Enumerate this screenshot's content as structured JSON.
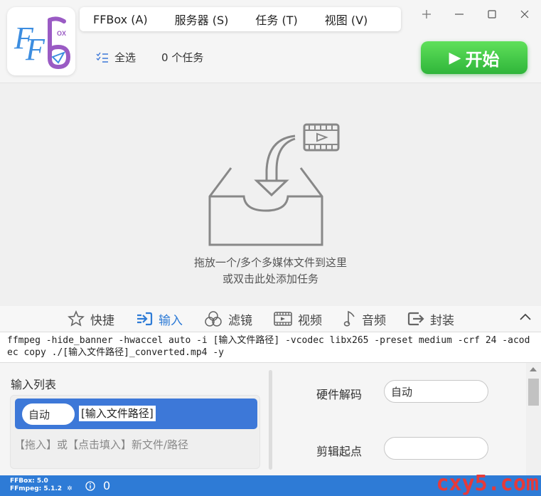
{
  "menubar": {
    "items": [
      "FFBox (A)",
      "服务器 (S)",
      "任务 (T)",
      "视图 (V)"
    ]
  },
  "window_buttons": [
    "new-window",
    "minimize",
    "maximize",
    "close"
  ],
  "toolbar": {
    "select_all": "全选",
    "task_count": "0 个任务",
    "start_label": "开始"
  },
  "dropzone": {
    "line1": "拖放一个/多个多媒体文件到这里",
    "line2": "或双击此处添加任务"
  },
  "tabs": [
    {
      "label": "快捷",
      "icon": "star-icon"
    },
    {
      "label": "输入",
      "icon": "input-icon",
      "active": true
    },
    {
      "label": "滤镜",
      "icon": "filter-icon"
    },
    {
      "label": "视频",
      "icon": "film-icon"
    },
    {
      "label": "音频",
      "icon": "music-note-icon"
    },
    {
      "label": "封装",
      "icon": "package-icon"
    }
  ],
  "command": "ffmpeg -hide_banner -hwaccel auto -i [输入文件路径] -vcodec libx265 -preset medium -crf 24 -acodec copy ./[输入文件路径]_converted.mp4 -y",
  "input_panel": {
    "title": "输入列表",
    "row_mode": "自动",
    "row_path": "[输入文件路径]",
    "add_hint": "【拖入】或【点击填入】新文件/路径"
  },
  "params": {
    "hw_decode_label": "硬件解码",
    "hw_decode_value": "自动",
    "clip_start_label": "剪辑起点",
    "clip_start_value": ""
  },
  "statusbar": {
    "ffbox_version": "FFBox: 5.0",
    "ffmpeg_version": "FFmpeg: 5.1.2",
    "notification_count": "0"
  },
  "watermark": "cxy5.com",
  "colors": {
    "accent": "#2e7bd6",
    "start_button": "#3cc048",
    "selected_row": "#3d78d8",
    "watermark": "#e63a3a"
  }
}
